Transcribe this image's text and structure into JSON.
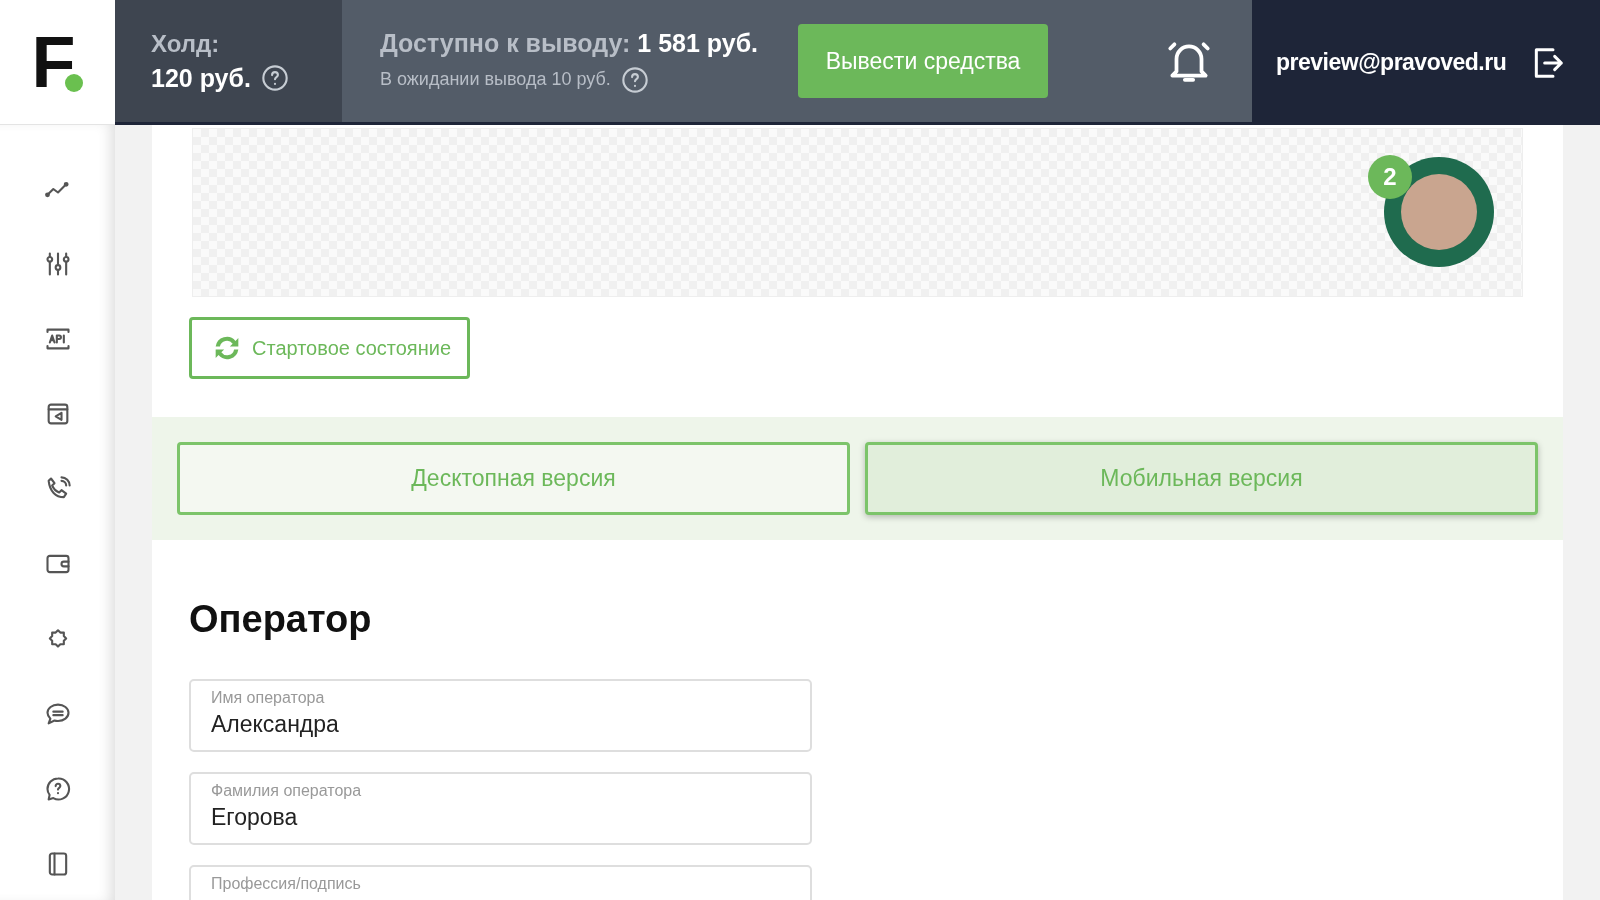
{
  "logo": "F",
  "header": {
    "hold_label": "Холд:",
    "hold_value": "120 руб.",
    "available": "Доступно к выводу: **1 581 руб.**",
    "pending": "В ожидании вывода 10 руб.",
    "withdraw_button": "Вывести средства",
    "email": "preview@pravoved.ru"
  },
  "sidebar": {
    "items": [
      {
        "kind": "chart"
      },
      {
        "kind": "sliders"
      },
      {
        "kind": "api"
      },
      {
        "kind": "widget"
      },
      {
        "kind": "phone"
      },
      {
        "kind": "wallet"
      },
      {
        "kind": "gear"
      },
      {
        "kind": "chat"
      },
      {
        "kind": "help"
      },
      {
        "kind": "document"
      }
    ]
  },
  "preview": {
    "badge": "2"
  },
  "reset_button": "Стартовое состояние",
  "tabs": [
    {
      "label": "Десктопная версия",
      "selected": false
    },
    {
      "label": "Мобильная версия",
      "selected": true
    }
  ],
  "section_title": "Оператор",
  "fields": [
    {
      "label": "Имя оператора",
      "value": "Александра"
    },
    {
      "label": "Фамилия оператора",
      "value": "Егорова"
    },
    {
      "label": "Профессия/подпись"
    }
  ]
}
